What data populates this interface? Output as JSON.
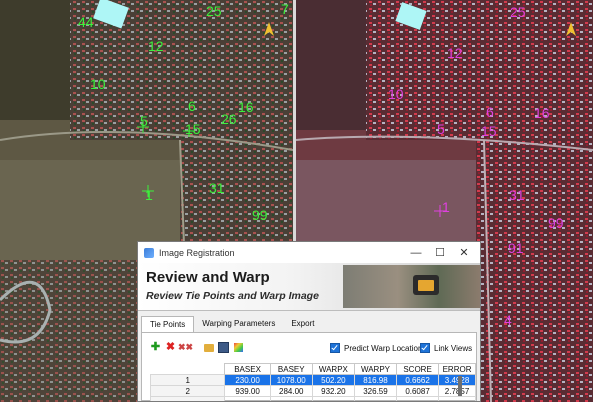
{
  "tie_points_left": [
    {
      "label": "44"
    },
    {
      "label": "25"
    },
    {
      "label": "7"
    },
    {
      "label": "12"
    },
    {
      "label": "10"
    },
    {
      "label": "6"
    },
    {
      "label": "16"
    },
    {
      "label": "5"
    },
    {
      "label": "15"
    },
    {
      "label": "26"
    },
    {
      "label": "1"
    },
    {
      "label": "31"
    },
    {
      "label": "99"
    }
  ],
  "tie_points_right": [
    {
      "label": "25"
    },
    {
      "label": "12"
    },
    {
      "label": "10"
    },
    {
      "label": "6"
    },
    {
      "label": "16"
    },
    {
      "label": "5"
    },
    {
      "label": "15"
    },
    {
      "label": "1"
    },
    {
      "label": "31"
    },
    {
      "label": "99"
    },
    {
      "label": "91"
    },
    {
      "label": "4"
    }
  ],
  "colors": {
    "left_label": "#3cf03c",
    "right_label": "#e040e0",
    "selected_row": "#1a73e8"
  },
  "dialog": {
    "title": "Image Registration",
    "minimize": "—",
    "maximize": "☐",
    "close": "✕",
    "banner_title": "Review and Warp",
    "banner_subtitle": "Review Tie Points and Warp Image",
    "tabs": [
      {
        "label": "Tie Points"
      },
      {
        "label": "Warping Parameters"
      },
      {
        "label": "Export"
      }
    ],
    "predict_label": "Predict Warp Location",
    "link_label": "Link Views",
    "table": {
      "headers": [
        "BASEX",
        "BASEY",
        "WARPX",
        "WARPY",
        "SCORE",
        "ERROR"
      ],
      "rows": [
        {
          "n": "1",
          "c": [
            "230.00",
            "1078.00",
            "502.20",
            "816.98",
            "0.6662",
            "3.4928"
          ]
        },
        {
          "n": "2",
          "c": [
            "939.00",
            "284.00",
            "932.20",
            "326.59",
            "0.6087",
            "2.7857"
          ]
        },
        {
          "n": "",
          "c": [
            "",
            "",
            "",
            "",
            "",
            ""
          ]
        }
      ]
    }
  }
}
